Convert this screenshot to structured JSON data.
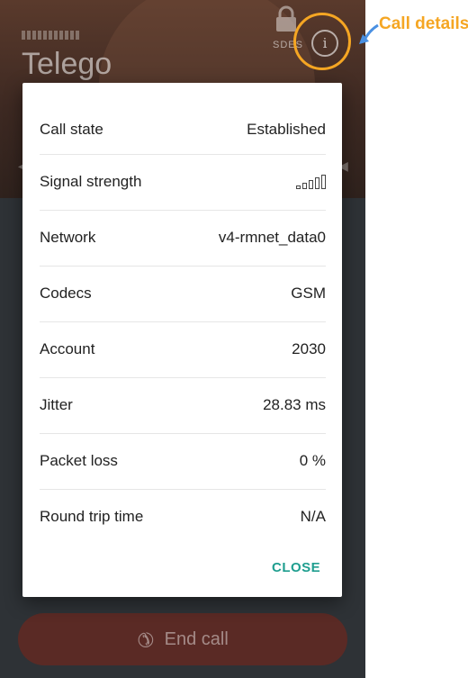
{
  "app": {
    "name": "Telego"
  },
  "header": {
    "srtp_label": "SDES"
  },
  "annotation": {
    "label": "Call details"
  },
  "dialog": {
    "rows": [
      {
        "label": "Call state",
        "value": "Established"
      },
      {
        "label": "Signal strength",
        "value": "",
        "signal_bars": 5
      },
      {
        "label": "Network",
        "value": "v4-rmnet_data0"
      },
      {
        "label": "Codecs",
        "value": "GSM"
      },
      {
        "label": "Account",
        "value": "2030"
      },
      {
        "label": "Jitter",
        "value": "28.83 ms"
      },
      {
        "label": "Packet loss",
        "value": "0 %"
      },
      {
        "label": "Round trip time",
        "value": "N/A"
      }
    ],
    "close_label": "CLOSE"
  },
  "end_call": {
    "label": "End call",
    "icon": "phone-hangup-icon"
  },
  "colors": {
    "accent": "#f5a623",
    "close": "#1f9e8f",
    "end_call_bg": "#5a2a25"
  }
}
